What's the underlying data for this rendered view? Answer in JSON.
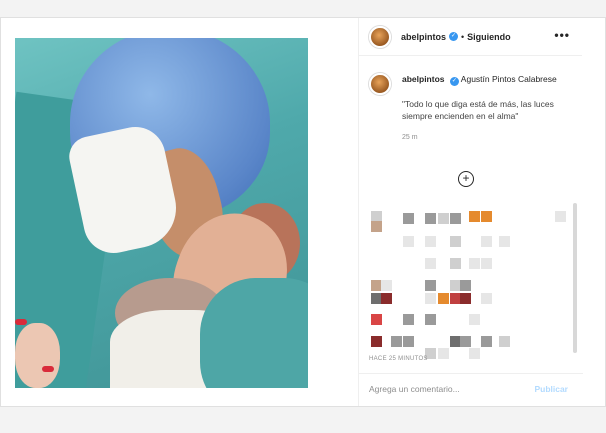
{
  "post": {
    "username": "abelpintos",
    "follow_status": "Siguiendo",
    "separator": "•",
    "more_glyph": "•••",
    "caption": {
      "username": "abelpintos",
      "mention": "Agustín Pintos Calabrese",
      "quote": "\"Todo lo que diga está de más, las luces siempre encienden en el alma\"",
      "time": "25 m"
    },
    "load_more_glyph": "+",
    "timestamp": "HACE 25 MINUTOS",
    "comment_placeholder": "Agrega un comentario...",
    "publish_label": "Publicar"
  },
  "colors": {
    "verified": "#3897f0",
    "publish": "#b3dbff",
    "scrub_tiles": [
      "#cfcfcf",
      "#9a9a9a",
      "#e58a2e",
      "#6e6e6e",
      "#c04040",
      "#8a2c2c",
      "#c4a38a",
      "#e6e6e6",
      "#d94545"
    ]
  }
}
